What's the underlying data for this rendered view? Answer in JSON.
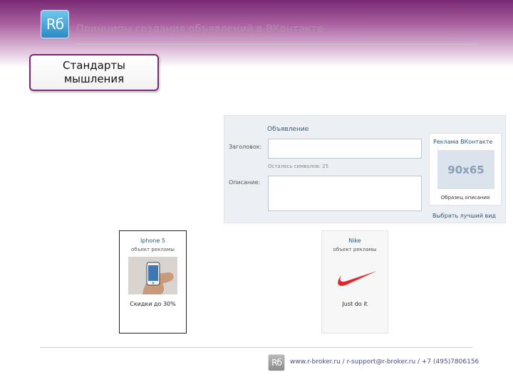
{
  "header": {
    "logo_text": "Rб",
    "title": "Принципы создания объявлений в ВКонтакте"
  },
  "section": {
    "label": "Стандарты мышления"
  },
  "vk_form": {
    "title": "Объявление",
    "headline_label": "Заголовок:",
    "chars_left": "Осталось символов: 25",
    "description_label": "Описание:",
    "preview": {
      "title": "Реклама ВКонтакте",
      "image_size": "90x65",
      "description": "Образец описания"
    },
    "choose_link": "Выбрать лучший вид"
  },
  "ads": [
    {
      "title": "Iphone 5",
      "subtitle": "объект рекламы",
      "footer": "Скидки до 30%",
      "image_icon": "hand-holding-phone-image"
    },
    {
      "title": "Nike",
      "subtitle": "объект рекламы",
      "footer": "Just do it",
      "image_icon": "nike-swoosh-logo"
    }
  ],
  "footer": {
    "logo_text": "Rб",
    "contact": "www.r-broker.ru / r-support@r-broker.ru / +7 (495)7806156"
  },
  "colors": {
    "brand_purple": "#7a2a73",
    "vk_blue": "#2b587a",
    "nike_red": "#e0282b"
  }
}
